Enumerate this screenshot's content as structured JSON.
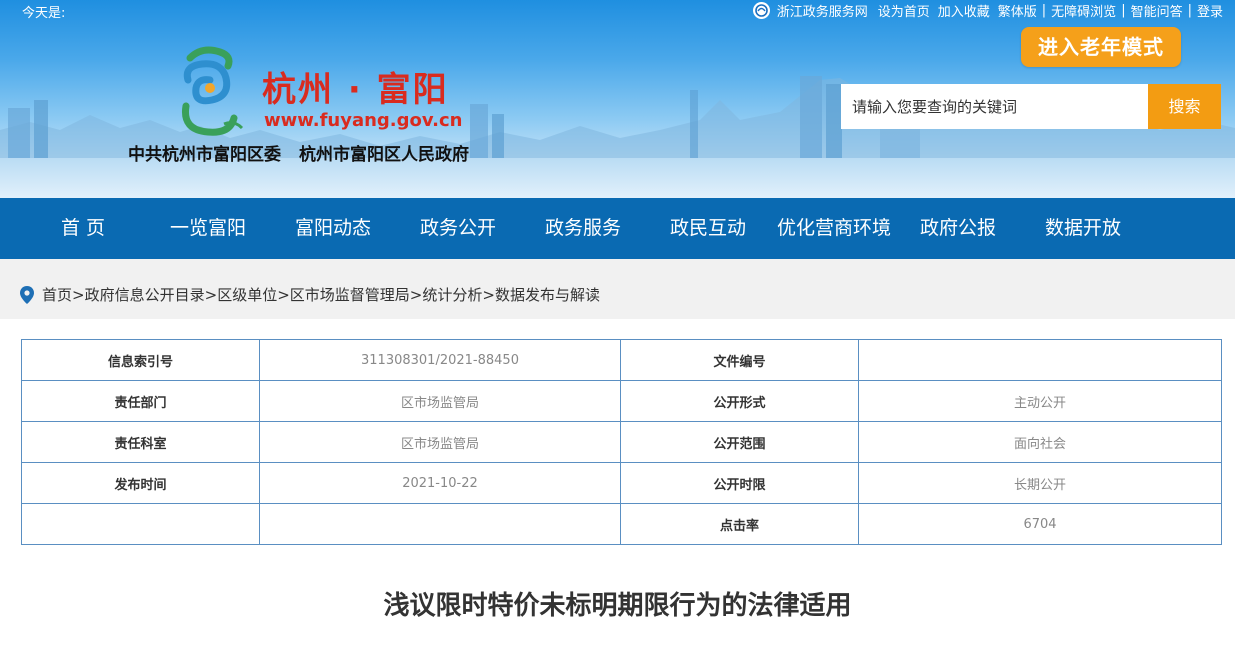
{
  "topbar": {
    "today_label": "今天是:",
    "links": [
      "浙江政务服务网",
      "设为首页",
      "加入收藏",
      "繁体版",
      "无障碍浏览",
      "智能问答",
      "登录"
    ]
  },
  "header": {
    "site_name": "杭州 · 富阳",
    "site_url": "www.fuyang.gov.cn",
    "org_party": "中共杭州市富阳区委",
    "org_gov": "杭州市富阳区人民政府",
    "elder_mode": "进入老年模式",
    "search_placeholder": "请输入您要查询的关键词",
    "search_button": "搜索"
  },
  "nav": [
    "首 页",
    "一览富阳",
    "富阳动态",
    "政务公开",
    "政务服务",
    "政民互动",
    "优化营商环境",
    "政府公报",
    "数据开放"
  ],
  "breadcrumb": [
    "首页",
    "政府信息公开目录",
    "区级单位",
    "区市场监督管理局",
    "统计分析",
    "数据发布与解读"
  ],
  "meta": {
    "index_label": "信息索引号",
    "index_value": "311308301/2021-88450",
    "docno_label": "文件编号",
    "docno_value": "",
    "dept_label": "责任部门",
    "dept_value": "区市场监管局",
    "form_label": "公开形式",
    "form_value": "主动公开",
    "office_label": "责任科室",
    "office_value": "区市场监管局",
    "scope_label": "公开范围",
    "scope_value": "面向社会",
    "date_label": "发布时间",
    "date_value": "2021-10-22",
    "term_label": "公开时限",
    "term_value": "长期公开",
    "clicks_label": "点击率",
    "clicks_value": "6704"
  },
  "article": {
    "title": "浅议限时特价未标明期限行为的法律适用"
  },
  "colors": {
    "nav_bg": "#0a6ab2",
    "accent_orange": "#f39c12",
    "brand_red": "#d92b1f",
    "table_border": "#5a8fc2"
  }
}
